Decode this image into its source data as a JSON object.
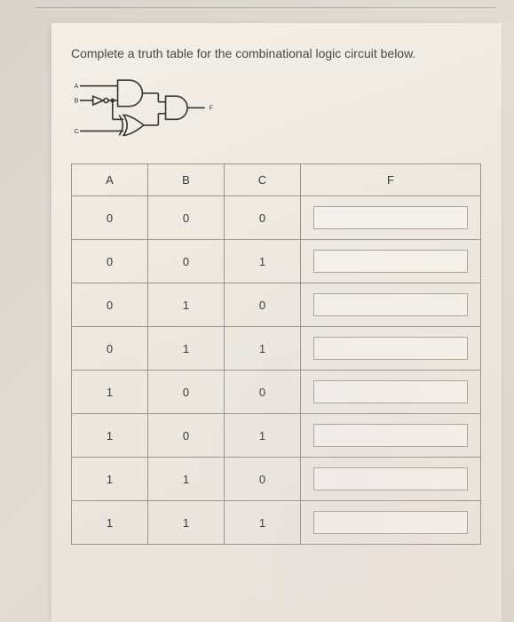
{
  "prompt": "Complete a truth table for the combinational logic circuit below.",
  "circuit": {
    "inputs": {
      "a": "A",
      "b": "B",
      "c": "C"
    },
    "output": "F"
  },
  "table": {
    "headers": {
      "a": "A",
      "b": "B",
      "c": "C",
      "f": "F"
    },
    "rows": [
      {
        "a": "0",
        "b": "0",
        "c": "0",
        "f": ""
      },
      {
        "a": "0",
        "b": "0",
        "c": "1",
        "f": ""
      },
      {
        "a": "0",
        "b": "1",
        "c": "0",
        "f": ""
      },
      {
        "a": "0",
        "b": "1",
        "c": "1",
        "f": ""
      },
      {
        "a": "1",
        "b": "0",
        "c": "0",
        "f": ""
      },
      {
        "a": "1",
        "b": "0",
        "c": "1",
        "f": ""
      },
      {
        "a": "1",
        "b": "1",
        "c": "0",
        "f": ""
      },
      {
        "a": "1",
        "b": "1",
        "c": "1",
        "f": ""
      }
    ]
  }
}
